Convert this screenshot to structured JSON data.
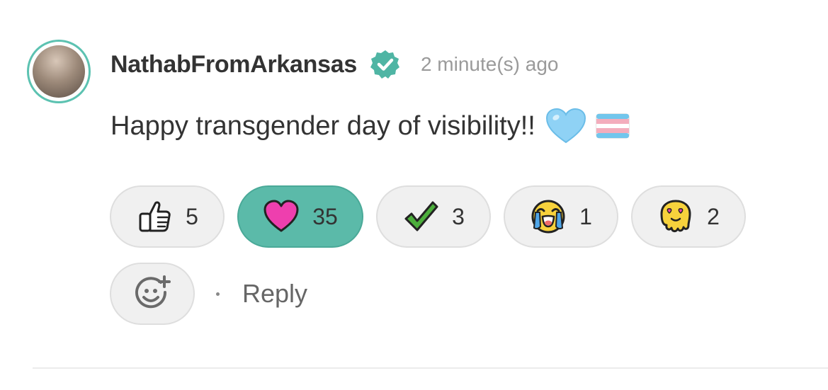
{
  "comment": {
    "author": "NathabFromArkansas",
    "verified_icon": "verified-badge-icon",
    "timestamp": "2 minute(s) ago",
    "text": "Happy transgender day of visibility!!",
    "text_emojis": [
      "light-blue-heart-emoji",
      "transgender-flag-emoji"
    ]
  },
  "reactions": [
    {
      "icon": "thumbs-up-icon",
      "count": "5",
      "active": false
    },
    {
      "icon": "heart-icon",
      "count": "35",
      "active": true
    },
    {
      "icon": "check-mark-icon",
      "count": "3",
      "active": false
    },
    {
      "icon": "crying-face-icon",
      "count": "1",
      "active": false
    },
    {
      "icon": "melting-heart-eyes-icon",
      "count": "2",
      "active": false
    }
  ],
  "actions": {
    "add_reaction_icon": "add-reaction-icon",
    "reply_label": "Reply"
  },
  "colors": {
    "accent": "#5bbaa9",
    "verified": "#4fb5a4",
    "heart": "#ee3fae",
    "check": "#4cae3c"
  }
}
